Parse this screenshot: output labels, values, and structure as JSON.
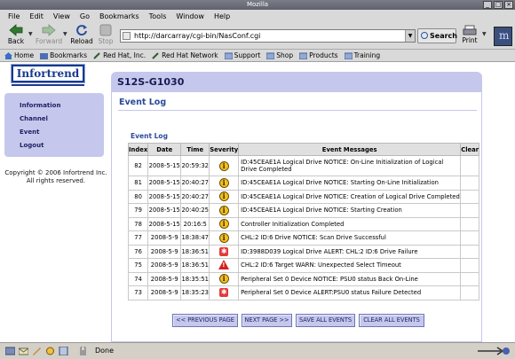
{
  "window": {
    "title": "Mozilla"
  },
  "menu": [
    "File",
    "Edit",
    "View",
    "Go",
    "Bookmarks",
    "Tools",
    "Window",
    "Help"
  ],
  "nav": {
    "back": "Back",
    "forward": "Forward",
    "reload": "Reload",
    "stop": "Stop",
    "url": "http://darcarray/cgi-bin/NasConf.cgi",
    "search": "Search",
    "print": "Print"
  },
  "bookmarks": [
    "Home",
    "Bookmarks",
    "Red Hat, Inc.",
    "Red Hat Network",
    "Support",
    "Shop",
    "Products",
    "Training"
  ],
  "brand": {
    "logo": "Infortrend",
    "model": "S12S-G1030"
  },
  "sidebar": {
    "items": [
      "Information",
      "Channel",
      "Event",
      "Logout"
    ]
  },
  "copyright": {
    "line1": "Copyright © 2006 Infortrend Inc.",
    "line2": "All rights reserved."
  },
  "page": {
    "title": "Event Log",
    "table_title": "Event Log"
  },
  "table": {
    "headers": [
      "Index",
      "Date",
      "Time",
      "Severity",
      "Event Messages",
      "Clear"
    ],
    "rows": [
      {
        "index": "82",
        "date": "2008-5-15",
        "time": "20:59:32",
        "severity": "info",
        "message": "ID:45CEAE1A Logical Drive NOTICE: On-Line Initialization of Logical Drive Completed"
      },
      {
        "index": "81",
        "date": "2008-5-15",
        "time": "20:40:27",
        "severity": "info",
        "message": "ID:45CEAE1A Logical Drive NOTICE: Starting On-Line Initialization"
      },
      {
        "index": "80",
        "date": "2008-5-15",
        "time": "20:40:27",
        "severity": "info",
        "message": "ID:45CEAE1A Logical Drive NOTICE: Creation of Logical Drive Completed"
      },
      {
        "index": "79",
        "date": "2008-5-15",
        "time": "20:40:25",
        "severity": "info",
        "message": "ID:45CEAE1A Logical Drive NOTICE: Starting Creation"
      },
      {
        "index": "78",
        "date": "2008-5-15",
        "time": "20:16:5",
        "severity": "info",
        "message": "Controller Initialization Completed"
      },
      {
        "index": "77",
        "date": "2008-5-9",
        "time": "18:38:47",
        "severity": "info",
        "message": "CHL:2 ID:6 Drive NOTICE: Scan Drive Successful"
      },
      {
        "index": "76",
        "date": "2008-5-9",
        "time": "18:36:51",
        "severity": "alert",
        "message": "ID:3988D039 Logical Drive ALERT: CHL:2 ID:6 Drive Failure"
      },
      {
        "index": "75",
        "date": "2008-5-9",
        "time": "18:36:51",
        "severity": "warn",
        "message": "CHL:2 ID:6 Target WARN: Unexpected Select Timeout"
      },
      {
        "index": "74",
        "date": "2008-5-9",
        "time": "18:35:51",
        "severity": "info",
        "message": "Peripheral Set 0 Device NOTICE: PSU0 status Back On-Line"
      },
      {
        "index": "73",
        "date": "2008-5-9",
        "time": "18:35:23",
        "severity": "alert",
        "message": "Peripheral Set 0 Device ALERT:PSU0 status Failure Detected"
      }
    ]
  },
  "buttons": {
    "prev": "<< PREVIOUS PAGE",
    "next": "NEXT PAGE >>",
    "save": "SAVE ALL EVENTS",
    "clear": "CLEAR ALL EVENTS"
  },
  "status": {
    "text": "Done"
  },
  "colors": {
    "accent": "#c5c8ec",
    "brand": "#173a8e",
    "alert": "#e33b3b",
    "info": "#f2c11d"
  }
}
